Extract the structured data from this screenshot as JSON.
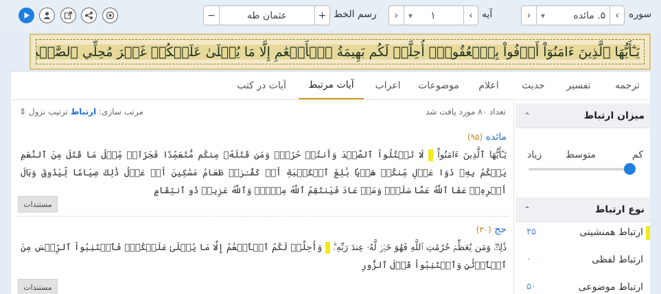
{
  "toolbar": {
    "surah_label": "سوره",
    "surah_value": "۵. مائده",
    "ayah_label": "آیه",
    "ayah_value": "۱",
    "script_label": "رسم الخط",
    "script_value": "عثمان طه",
    "prev_glyph": "‹",
    "next_glyph": "›",
    "dropdown_glyph": "▾",
    "plus_glyph": "+",
    "minus_glyph": "−",
    "play_icon": "play-icon",
    "reciter_icon": "user-icon",
    "external_icon": "external-link-icon",
    "share_icon": "share-icon",
    "target_icon": "target-icon"
  },
  "verse": {
    "text": "يَـٰٓأَيُّهَا ٱلَّذِينَ ءَامَنُوٓاْ أَوۡفُواْ بِٱلۡعُقُودِۚ أُحِلَّتۡ لَكُم بَهِيمَةُ ٱلۡأَنۡعَٰمِ إِلَّا مَا يُتۡلَىٰ عَلَيۡكُمۡ غَيۡرَ مُحِلِّي ٱلصَّيۡدِ وَأَنتُمۡ حُرُمٌۗ إِنَّ ٱللَّهَ يَحۡكُمُ مَا يُرِيدُ"
  },
  "tabs": [
    {
      "label": "ترجمه",
      "active": false
    },
    {
      "label": "تفسیر",
      "active": false
    },
    {
      "label": "حدیث",
      "active": false
    },
    {
      "label": "اعلام",
      "active": false
    },
    {
      "label": "موضوعات",
      "active": false
    },
    {
      "label": "اعراب",
      "active": false
    },
    {
      "label": "آیات مرتبط",
      "active": true
    },
    {
      "label": "آیات در کتب",
      "active": false
    }
  ],
  "sidebar": {
    "relevance_title": "میزان ارتباط",
    "relevance_levels": [
      "کم",
      "متوسط",
      "زیاد"
    ],
    "relevance_value": 0,
    "type_title": "نوع ارتباط",
    "types": [
      {
        "name": "ارتباط همنشینی",
        "count": "۴۵",
        "highlight": true
      },
      {
        "name": "ارتباط لفظی",
        "count": "۰",
        "highlight": false
      },
      {
        "name": "ارتباط موضوعی",
        "count": "۵۰",
        "highlight": false
      }
    ],
    "chevron_glyph": "⌃"
  },
  "results": {
    "count_text": "تعداد ۸۰ مورد یافت شد",
    "sort_label": "مرتب سازی:",
    "sort_active": "ارتباط",
    "sort_other": "ترتیب نزول",
    "sort_icon": "⇕",
    "items": [
      {
        "surah": "مائده",
        "number": "(۹۵)",
        "text_before": "يَـٰٓأَيُّهَا ٱلَّذِينَ ءَامَنُواْ",
        "text_after": "لَا تَقۡتُلُواْ ٱلصَّيۡدَ وَأَنتُمۡ حُرُمٞۚ وَمَن قَتَلَهُۥ مِنكُم مُّتَعَمِّدٗا فَجَزَآءٞ مِّثۡلُ مَا قَتَلَ مِنَ ٱلنَّعَمِ يَحۡكُمُ بِهِۦ ذَوَا عَدۡلٖ مِّنكُمۡ هَدۡيَۢا بَٰلِغَ ٱلۡكَعۡبَةِ أَوۡ كَفَّـٰرَةٞ طَعَامُ مَسَٰكِينَ أَوۡ عَدۡلُ ذَٰلِكَ صِيَامٗا لِّيَذُوقَ وَبَالَ أَمۡرِهِۦۗ عَفَا ٱللَّهُ عَمَّا سَلَفَۚ وَمَنۡ عَادَ فَيَنتَقِمُ ٱللَّهُ مِنۡهُۚ وَٱللَّهُ عَزِيزٞ ذُو ٱنتِقَامٍ",
        "docs": "مستندات"
      },
      {
        "surah": "حج",
        "number": "(۳۰)",
        "text_before": "ذَٰلِكَۖ وَمَن يُعَظِّمۡ حُرُمَٰتِ ٱللَّهِ فَهُوَ خَيۡرٞ لَّهُۥ عِندَ رَبِّهِۦۗ",
        "text_after": "وَأُحِلَّتۡ لَكُمُ ٱلۡأَنۡعَٰمُ إِلَّا مَا يُتۡلَىٰ عَلَيۡكُمۡۖ فَٱجۡتَنِبُواْ ٱلرِّجۡسَ مِنَ ٱلۡأَوۡثَٰنِ وَٱجۡتَنِبُواْ قَوۡلَ ٱلزُّورِ",
        "docs": "مستندات"
      }
    ]
  },
  "colors": {
    "accent": "#1f7fe0",
    "highlight": "#f2ea14",
    "banner_bg": "#f5e7c7",
    "tab_underline": "#d29a1e"
  }
}
